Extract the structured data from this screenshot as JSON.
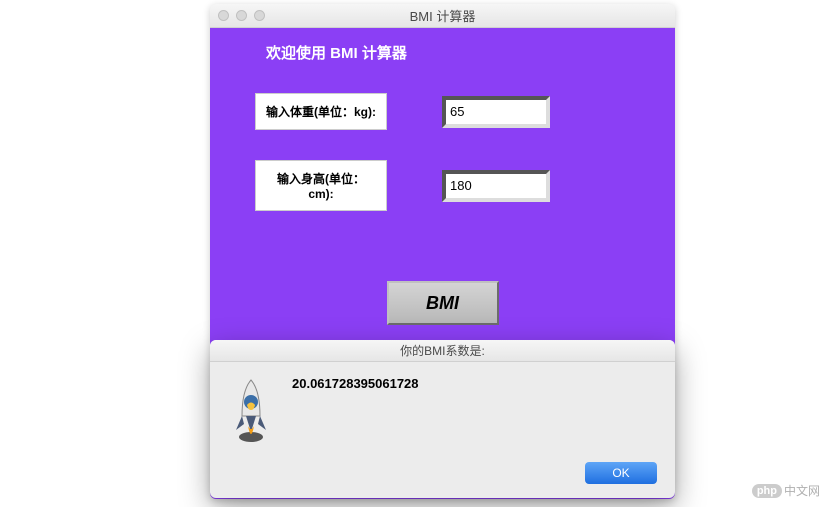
{
  "window": {
    "title": "BMI 计算器"
  },
  "app": {
    "welcome": "欢迎使用 BMI 计算器",
    "weight_label": "输入体重(单位：kg):",
    "height_label": "输入身高(单位：cm):",
    "weight_value": "65",
    "height_value": "180",
    "button_label": "BMI"
  },
  "dialog": {
    "title": "你的BMI系数是:",
    "message": "20.061728395061728",
    "ok_label": "OK"
  },
  "watermark": {
    "badge": "php",
    "text": "中文网"
  }
}
